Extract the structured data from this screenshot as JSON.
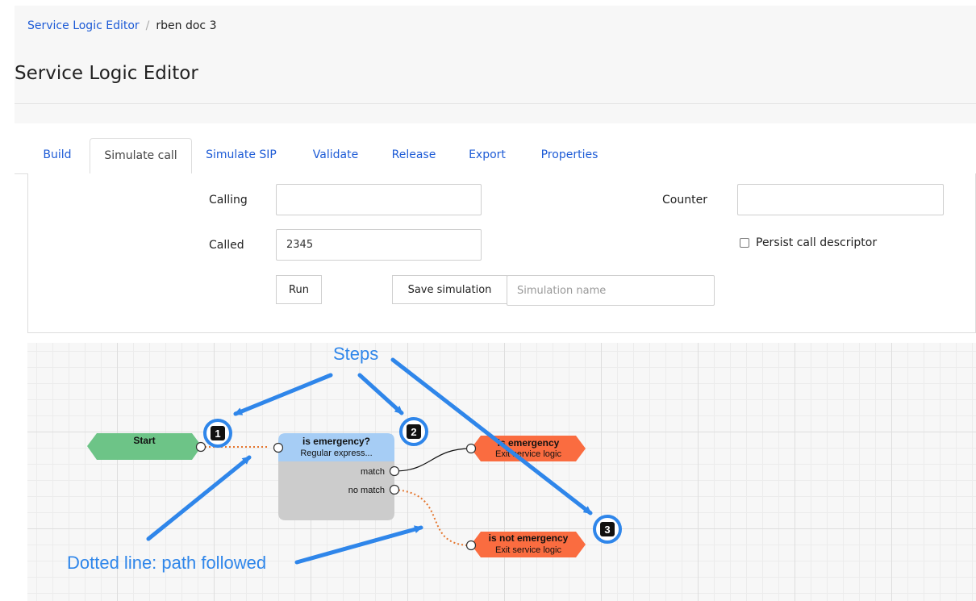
{
  "breadcrumb": {
    "root": "Service Logic Editor",
    "separator": "/",
    "current": "rben doc 3"
  },
  "page": {
    "title": "Service Logic Editor"
  },
  "tabs": [
    "Build",
    "Simulate call",
    "Simulate SIP",
    "Validate",
    "Release",
    "Export",
    "Properties"
  ],
  "active_tab": "Simulate call",
  "form": {
    "calling_label": "Calling",
    "calling_value": "",
    "called_label": "Called",
    "called_value": "2345",
    "counter_label": "Counter",
    "counter_value": "",
    "persist_label": "Persist call descriptor",
    "persist_checked": false,
    "run_label": "Run",
    "save_label": "Save simulation",
    "simulation_name_value": "",
    "simulation_name_placeholder": "Simulation name"
  },
  "flow": {
    "start": {
      "label": "Start"
    },
    "decision": {
      "title": "is emergency?",
      "subtitle": "Regular express...",
      "outputs": [
        "match",
        "no match"
      ]
    },
    "exit_match": {
      "title": "is emergency",
      "subtitle": "Exit service logic"
    },
    "exit_nomatch": {
      "title": "is not emergency",
      "subtitle": "Exit service logic"
    },
    "colors": {
      "start": "#6dc487",
      "decision_header": "#a6cdf5",
      "decision_body": "#cccccc",
      "exit": "#fa6c40",
      "path_followed": "#e5762e"
    }
  },
  "annotations": {
    "steps_title": "Steps",
    "step_numbers": [
      "1",
      "2",
      "3"
    ],
    "dotted_line": "Dotted line: path followed",
    "color": "#2f86ea"
  }
}
